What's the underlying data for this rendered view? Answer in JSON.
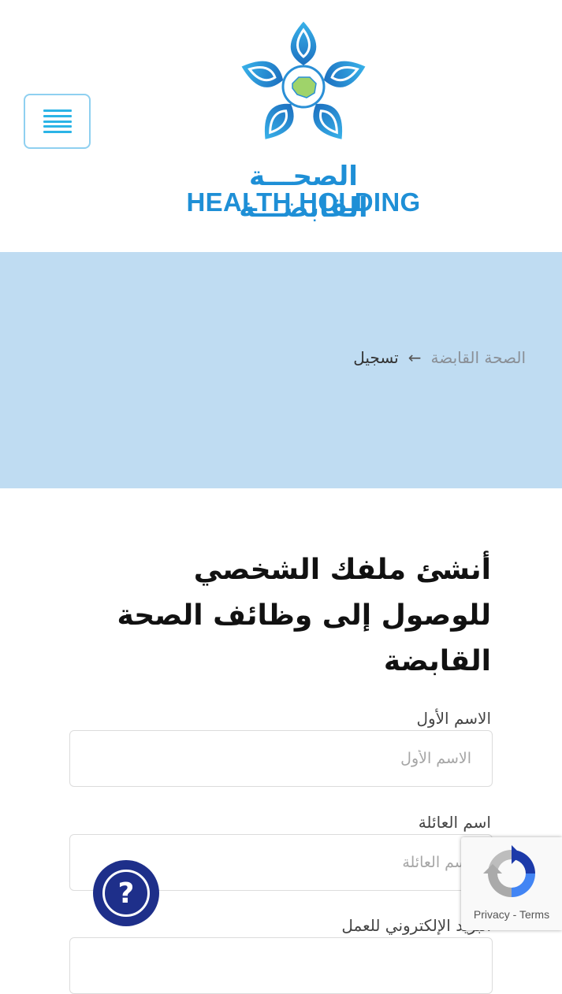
{
  "header": {
    "menu_icon": "hamburger-menu-icon",
    "logo": {
      "name_ar": "الصحـــة القابضـــة",
      "name_en": "HEALTH HOLDING"
    }
  },
  "banner": {
    "breadcrumb": {
      "home": "الصحة القابضة",
      "separator_icon": "arrow-left-icon",
      "current": "تسجيل"
    }
  },
  "page": {
    "title": "أنشئ ملفك الشخصي للوصول إلى وظائف الصحة القابضة"
  },
  "form": {
    "first_name": {
      "label": "الاسم الأول",
      "placeholder": "الاسم الأول",
      "value": ""
    },
    "last_name": {
      "label": "اسم العائلة",
      "placeholder": "اسم العائلة",
      "value": ""
    },
    "email": {
      "label": "البريد الإلكتروني للعمل",
      "placeholder": "",
      "value": ""
    }
  },
  "help_button": {
    "icon": "question-mark-icon",
    "glyph": "?"
  },
  "recaptcha": {
    "privacy": "Privacy",
    "separator": "-",
    "terms": "Terms"
  },
  "colors": {
    "brand_blue": "#1e8fd6",
    "banner_bg": "#bfdcf2",
    "help_button": "#1e2f8a",
    "menu_accent": "#2bb4e6"
  }
}
